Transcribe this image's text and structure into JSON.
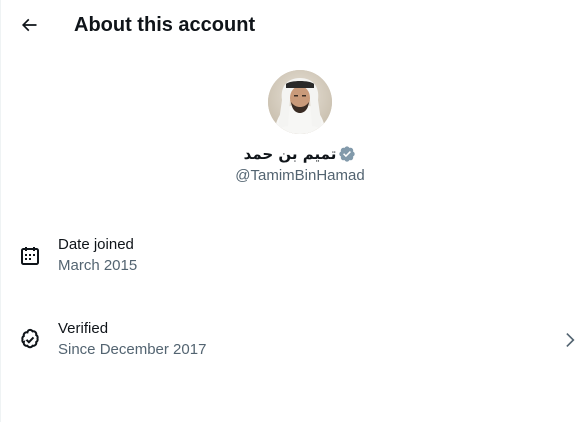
{
  "header": {
    "title": "About this account",
    "back_icon": "arrow-left-icon"
  },
  "profile": {
    "display_name": "تميم بن حمد",
    "handle": "@TamimBinHamad",
    "verified_icon": "verified-badge-icon",
    "verified_color": "#829aab"
  },
  "details": {
    "date_joined": {
      "icon": "calendar-icon",
      "label": "Date joined",
      "value": "March 2015"
    },
    "verified": {
      "icon": "verified-check-icon",
      "label": "Verified",
      "value": "Since December 2017",
      "chevron_icon": "chevron-right-icon"
    }
  },
  "colors": {
    "text_primary": "#0f1419",
    "text_secondary": "#536471",
    "border": "#eff3f4"
  }
}
